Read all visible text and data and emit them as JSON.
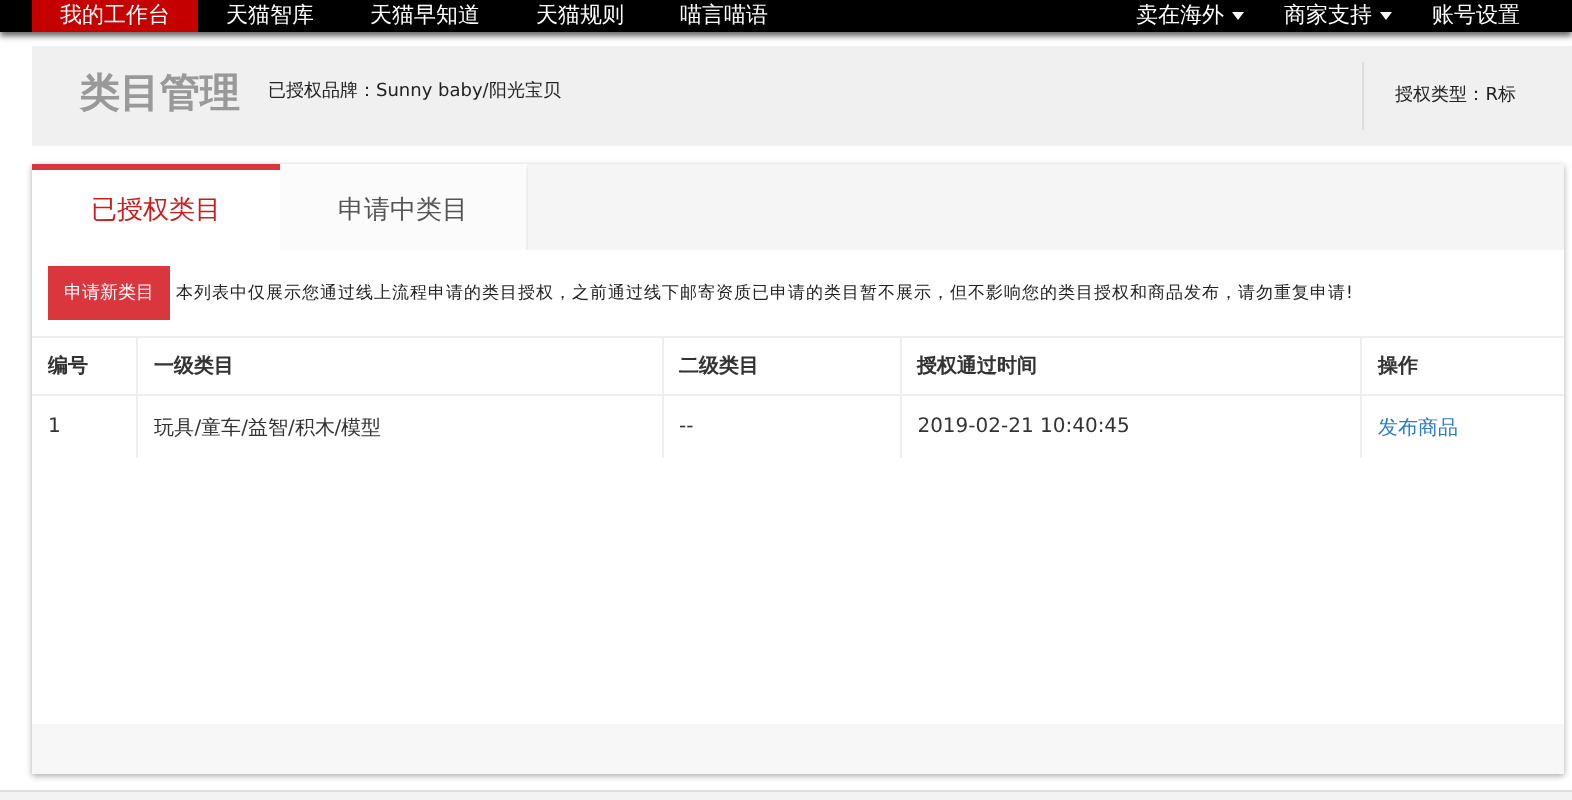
{
  "nav": {
    "items": [
      {
        "label": "我的工作台",
        "selected": true
      },
      {
        "label": "天猫智库",
        "selected": false
      },
      {
        "label": "天猫早知道",
        "selected": false
      },
      {
        "label": "天猫规则",
        "selected": false
      },
      {
        "label": "喵言喵语",
        "selected": false
      }
    ],
    "right_items": [
      {
        "label": "卖在海外",
        "dropdown": true
      },
      {
        "label": "商家支持",
        "dropdown": true
      },
      {
        "label": "账号设置",
        "dropdown": false
      }
    ]
  },
  "header": {
    "title": "类目管理",
    "brand": "已授权品牌：Sunny baby/阳光宝贝",
    "auth_type": "授权类型：R标"
  },
  "tabs": [
    {
      "label": "已授权类目",
      "selected": true
    },
    {
      "label": "申请中类目",
      "selected": false
    }
  ],
  "apply_button": "申请新类目",
  "notice": "本列表中仅展示您通过线上流程申请的类目授权，之前通过线下邮寄资质已申请的类目暂不展示，但不影响您的类目授权和商品发布，请勿重复申请!",
  "table": {
    "columns": [
      "编号",
      "一级类目",
      "二级类目",
      "授权通过时间",
      "操作"
    ],
    "rows": [
      {
        "cells": [
          "1",
          "玩具/童车/益智/积木/模型",
          "--",
          "2019-02-21 10:40:45"
        ],
        "action": "发布商品"
      }
    ]
  }
}
